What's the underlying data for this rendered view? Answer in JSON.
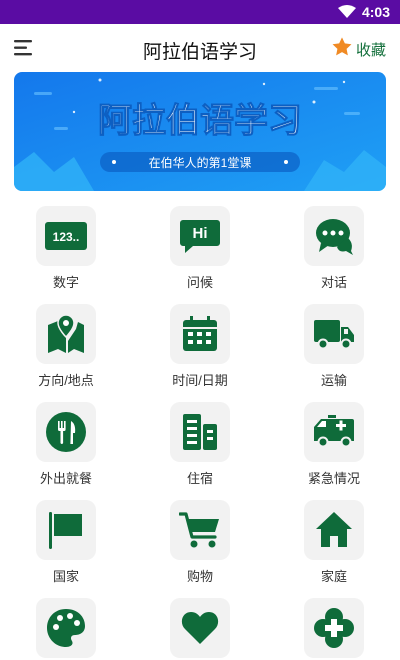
{
  "status": {
    "time": "4:03"
  },
  "appbar": {
    "title": "阿拉伯语学习",
    "favorite_label": "收藏"
  },
  "banner": {
    "title": "阿拉伯语学习",
    "subtitle": "在伯华人的第1堂课"
  },
  "categories": [
    {
      "label": "数字",
      "icon": "numbers-icon",
      "icon_text": "123.."
    },
    {
      "label": "问候",
      "icon": "greeting-chat-icon",
      "icon_text": "Hi"
    },
    {
      "label": "对话",
      "icon": "conversation-icon"
    },
    {
      "label": "方向/地点",
      "icon": "map-location-icon"
    },
    {
      "label": "时间/日期",
      "icon": "calendar-icon"
    },
    {
      "label": "运输",
      "icon": "truck-icon"
    },
    {
      "label": "外出就餐",
      "icon": "restaurant-icon"
    },
    {
      "label": "住宿",
      "icon": "building-icon"
    },
    {
      "label": "紧急情况",
      "icon": "ambulance-icon"
    },
    {
      "label": "国家",
      "icon": "flag-icon"
    },
    {
      "label": "购物",
      "icon": "shopping-cart-icon"
    },
    {
      "label": "家庭",
      "icon": "home-icon"
    },
    {
      "label": "",
      "icon": "palette-icon"
    },
    {
      "label": "",
      "icon": "heart-icon"
    },
    {
      "label": "",
      "icon": "clover-cross-icon"
    }
  ],
  "colors": {
    "status_bar": "#5a0ca3",
    "accent_green": "#14703c",
    "icon_green": "#0f6b3a",
    "star": "#f08a24",
    "banner_blue": "#1a8bf0"
  }
}
